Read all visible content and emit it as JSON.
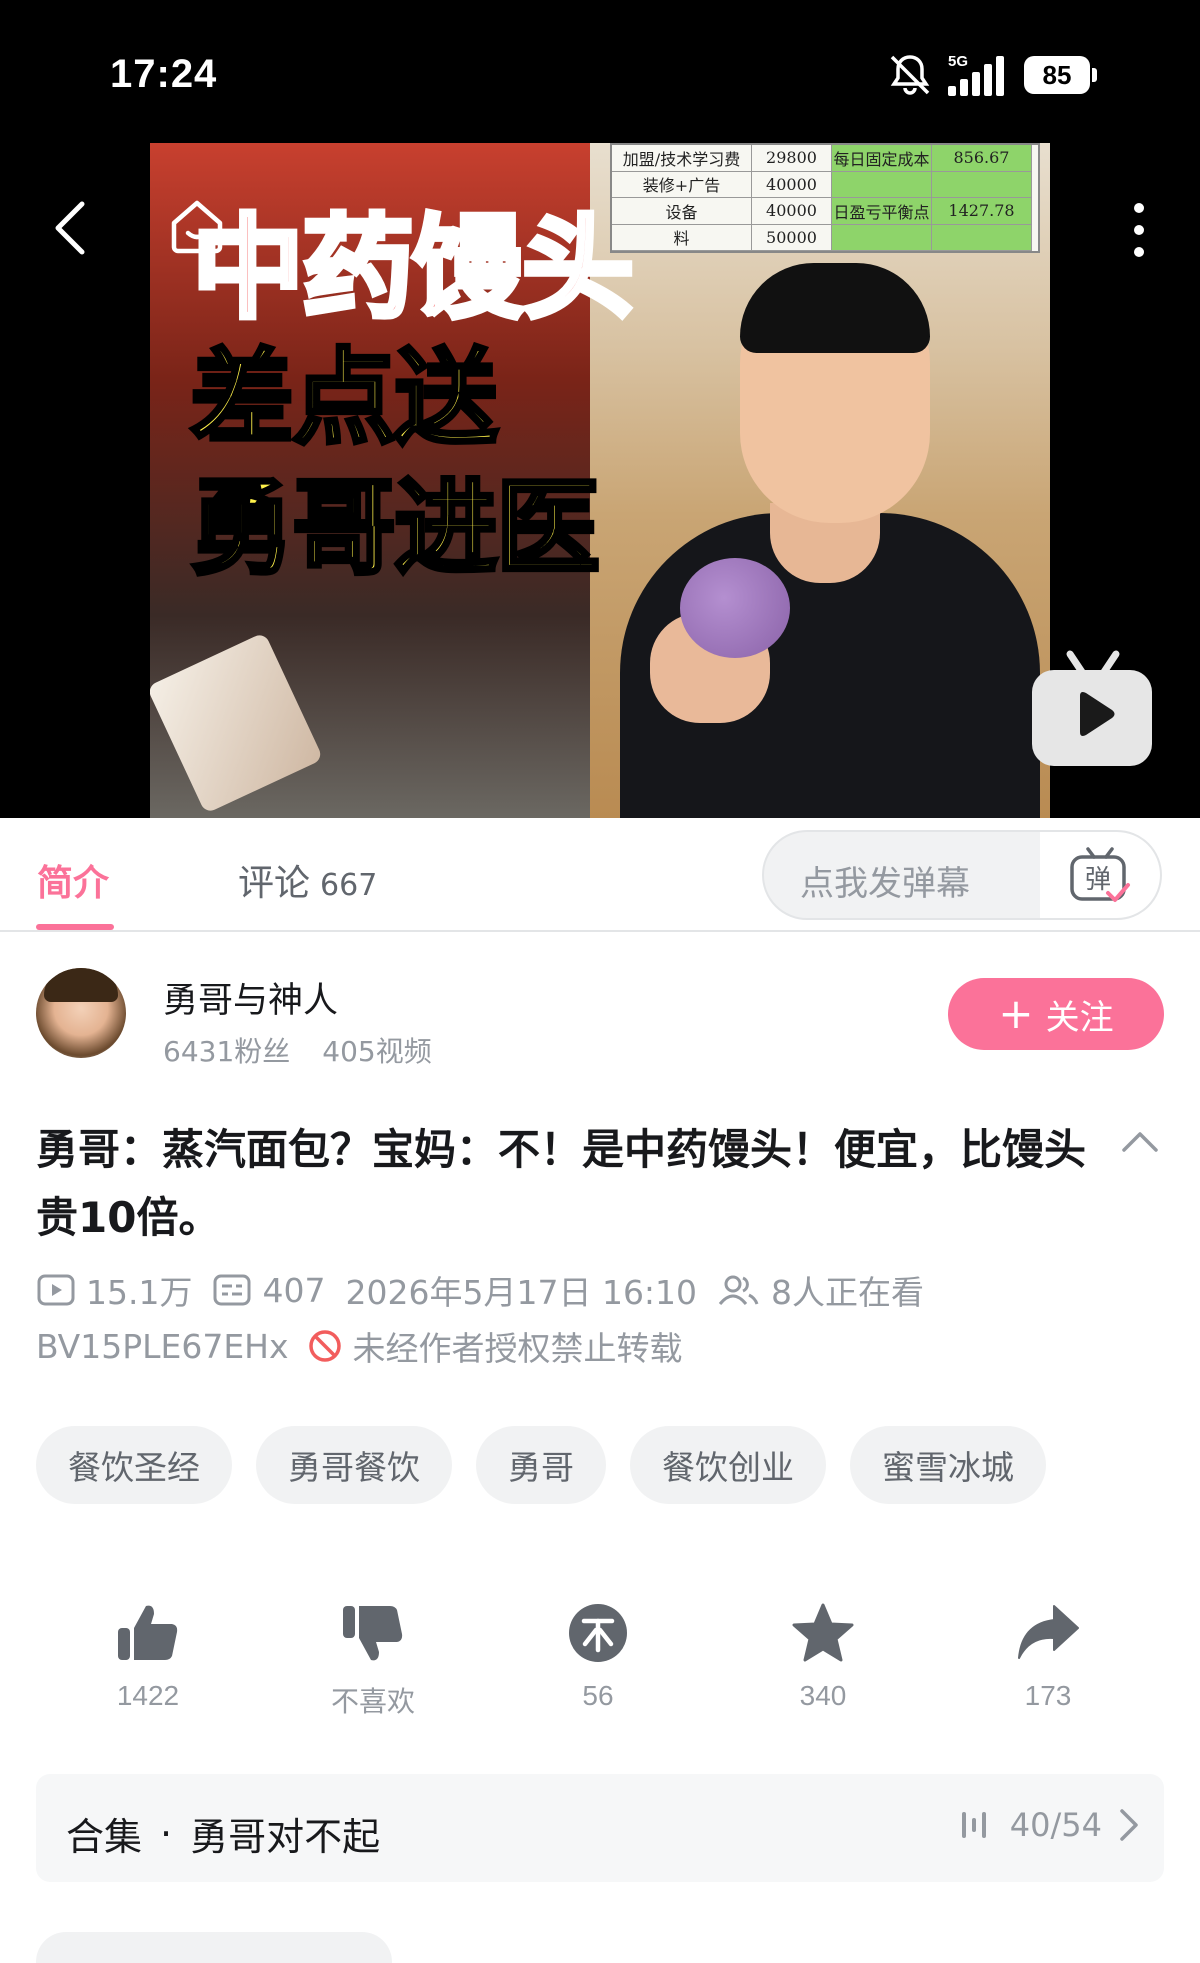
{
  "status_bar": {
    "time": "17:24",
    "network": "5G",
    "battery": "85"
  },
  "video": {
    "thumbnail_overlay": [
      "中药馒头",
      "差点送",
      "勇哥进医"
    ],
    "sheet": [
      [
        "加盟/技术学习费",
        "29800",
        "每日固定成本",
        "856.67"
      ],
      [
        "装修+广告",
        "40000",
        "",
        ""
      ],
      [
        "设备",
        "40000",
        "日盈亏平衡点",
        "1427.78"
      ],
      [
        "料",
        "50000",
        "",
        ""
      ]
    ],
    "icons": [
      "back-icon",
      "home-icon",
      "more-icon",
      "play-icon"
    ]
  },
  "tabs": {
    "intro": "简介",
    "comments": "评论",
    "comments_count": "667",
    "danmaku_placeholder": "点我发弹幕",
    "danmaku_button": "弹"
  },
  "author": {
    "name": "勇哥与神人",
    "fans": "6431粉丝",
    "videos": "405视频",
    "follow": "关注",
    "follow_plus": "+"
  },
  "video_info": {
    "title": "勇哥：蒸汽面包？宝妈：不！是中药馒头！便宜，比馒头贵10倍。",
    "views": "15.1万",
    "danmaku_count": "407",
    "date": "2026年5月17日 16:10",
    "watching": "8人正在看",
    "bvid": "BV15PLE67EHx",
    "copyright": "未经作者授权禁止转载"
  },
  "tags": [
    "餐饮圣经",
    "勇哥餐饮",
    "勇哥",
    "餐饮创业",
    "蜜雪冰城"
  ],
  "actions": [
    {
      "icon": "thumbs-up-icon",
      "label": "1422"
    },
    {
      "icon": "thumbs-down-icon",
      "label": "不喜欢"
    },
    {
      "icon": "coin-icon",
      "label": "56"
    },
    {
      "icon": "star-icon",
      "label": "340"
    },
    {
      "icon": "share-icon",
      "label": "173"
    }
  ],
  "collection": {
    "label": "合集",
    "dot": "·",
    "name": "勇哥对不起",
    "progress": "40/54"
  },
  "colors": {
    "accent": "#fb7299",
    "text_primary": "#18191c",
    "text_secondary": "#9499a0"
  }
}
